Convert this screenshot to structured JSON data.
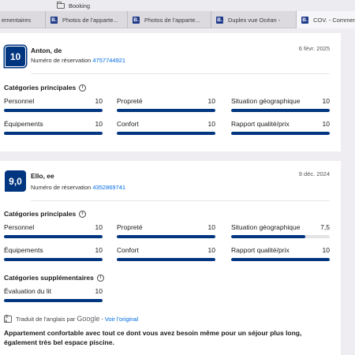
{
  "browser": {
    "bookmark_folder": "Booking",
    "tabs": [
      {
        "title": "ementaires",
        "favicon": ""
      },
      {
        "title": "Photos de l'apparte...",
        "favicon": "B."
      },
      {
        "title": "Photos de l'apparte...",
        "favicon": "B."
      },
      {
        "title": "Duplex vue Océan -",
        "favicon": "B."
      },
      {
        "title": "COV. - Commentai",
        "favicon": "B."
      }
    ]
  },
  "reviews": [
    {
      "score": "10",
      "name": "Anton, de",
      "reservation_label": "Numéro de réservation",
      "reservation_number": "4757744921",
      "date": "6 févr. 2025",
      "main_title": "Catégories principales",
      "main_categories": [
        {
          "label": "Personnel",
          "value": "10",
          "fraction": 1.0
        },
        {
          "label": "Propreté",
          "value": "10",
          "fraction": 1.0
        },
        {
          "label": "Situation géographique",
          "value": "10",
          "fraction": 1.0
        },
        {
          "label": "Équipements",
          "value": "10",
          "fraction": 1.0
        },
        {
          "label": "Confort",
          "value": "10",
          "fraction": 1.0
        },
        {
          "label": "Rapport qualité/prix",
          "value": "10",
          "fraction": 1.0
        }
      ]
    },
    {
      "score": "9,0",
      "name": "Ello, ee",
      "reservation_label": "Numéro de réservation",
      "reservation_number": "4352869741",
      "date": "9 déc. 2024",
      "main_title": "Catégories principales",
      "main_categories": [
        {
          "label": "Personnel",
          "value": "10",
          "fraction": 1.0
        },
        {
          "label": "Propreté",
          "value": "10",
          "fraction": 1.0
        },
        {
          "label": "Situation géographique",
          "value": "7,5",
          "fraction": 0.75
        },
        {
          "label": "Équipements",
          "value": "10",
          "fraction": 1.0
        },
        {
          "label": "Confort",
          "value": "10",
          "fraction": 1.0
        },
        {
          "label": "Rapport qualité/prix",
          "value": "10",
          "fraction": 1.0
        }
      ],
      "extra_title": "Catégories supplémentaires",
      "extra_categories": [
        {
          "label": "Évaluation du lit",
          "value": "10",
          "fraction": 1.0
        }
      ],
      "translation": {
        "prefix": "Traduit de l'anglais par",
        "provider": "Google",
        "separator": "-",
        "link": "Voir l'original"
      },
      "text": "Appartement confortable avec tout ce dont vous avez besoin même pour un séjour plus long, également très bel espace piscine."
    }
  ],
  "colors": {
    "brand": "#003580",
    "link": "#006ce4",
    "bar_track": "#e3e3e3"
  }
}
